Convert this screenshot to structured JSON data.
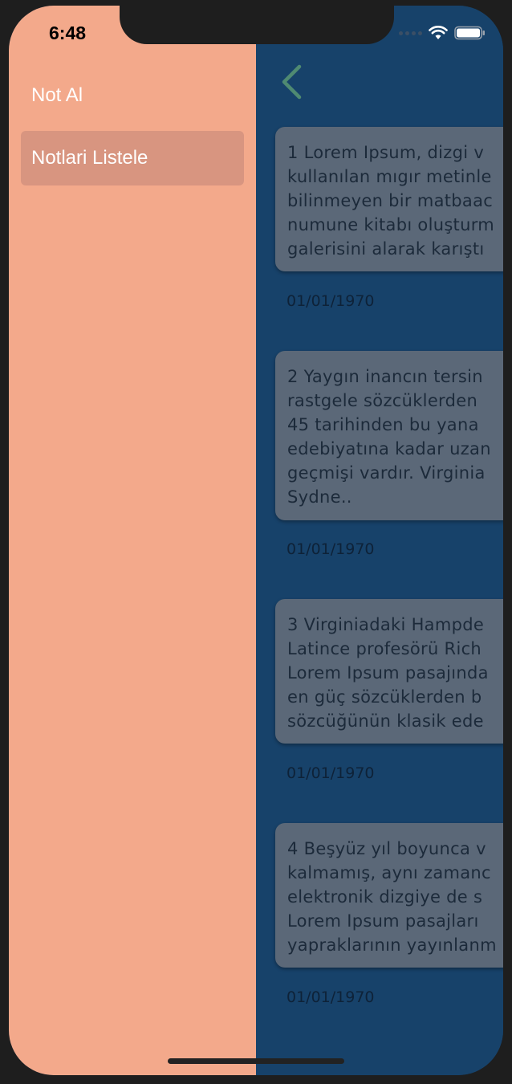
{
  "status_bar": {
    "time": "6:48"
  },
  "drawer": {
    "items": [
      {
        "label": "Not Al",
        "active": false
      },
      {
        "label": "Notlari Listele",
        "active": true
      }
    ]
  },
  "main": {
    "back_icon": "chevron-left-icon",
    "notes": [
      {
        "lines": [
          "1 Lorem Ipsum, dizgi v",
          "kullanılan mıgır metinle",
          "bilinmeyen bir matbaac",
          "numune kitabı oluşturm",
          "galerisini alarak karıştı"
        ],
        "date": "01/01/1970"
      },
      {
        "lines": [
          "2 Yaygın inancın tersin",
          "rastgele sözcüklerden",
          "45 tarihinden bu yana",
          "edebiyatına kadar uzan",
          "geçmişi vardır. Virginia",
          "Sydne.."
        ],
        "date": "01/01/1970"
      },
      {
        "lines": [
          "3 Virginiadaki Hampde",
          "Latince profesörü Rich",
          "Lorem Ipsum pasajında",
          "en güç sözcüklerden b",
          "sözcüğünün klasik ede"
        ],
        "date": "01/01/1970"
      },
      {
        "lines": [
          "4 Beşyüz yıl boyunca v",
          "kalmamış, aynı zamanc",
          "elektronik dizgiye de s",
          "Lorem Ipsum pasajları",
          "yapraklarının yayınlanm"
        ],
        "date": "01/01/1970"
      }
    ]
  },
  "colors": {
    "drawer_bg": "#f3a98b",
    "drawer_active_bg": "#d89580",
    "main_bg": "#17426a",
    "card_bg": "#5b6878",
    "back_icon": "#4f8a72"
  }
}
